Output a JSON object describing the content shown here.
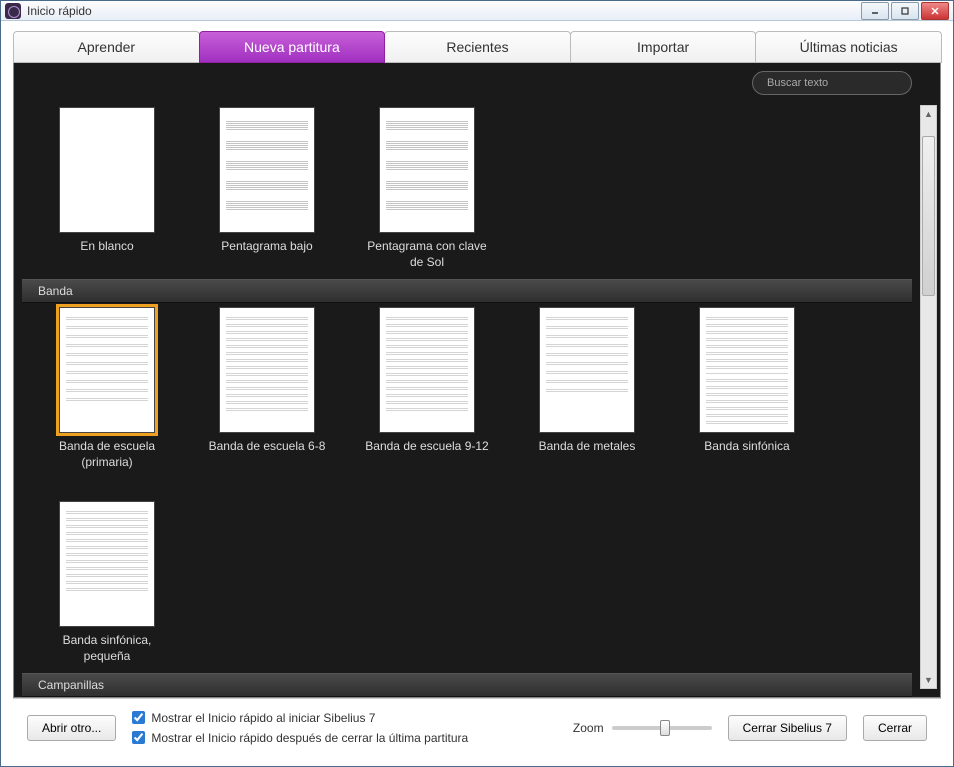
{
  "window_title": "Inicio rápido",
  "tabs": [
    {
      "label": "Aprender"
    },
    {
      "label": "Nueva partitura",
      "active": true
    },
    {
      "label": "Recientes"
    },
    {
      "label": "Importar"
    },
    {
      "label": "Últimas noticias"
    }
  ],
  "search_placeholder": "Buscar texto",
  "top_templates": [
    {
      "label": "En blanco",
      "type": "blank"
    },
    {
      "label": "Pentagrama bajo",
      "type": "staff5"
    },
    {
      "label": "Pentagrama con clave de Sol",
      "type": "staff5"
    }
  ],
  "section_banda": {
    "title": "Banda",
    "templates": [
      {
        "label": "Banda de escuela (primaria)",
        "selected": true
      },
      {
        "label": "Banda de escuela 6-8"
      },
      {
        "label": "Banda de escuela 9-12"
      },
      {
        "label": "Banda de metales"
      },
      {
        "label": "Banda sinfónica"
      },
      {
        "label": "Banda sinfónica, pequeña"
      }
    ]
  },
  "section_campanillas": {
    "title": "Campanillas"
  },
  "footer": {
    "open_other": "Abrir otro...",
    "check1": "Mostrar el Inicio rápido al iniciar Sibelius 7",
    "check2": "Mostrar el Inicio rápido después de cerrar la última partitura",
    "zoom": "Zoom",
    "close_sibelius": "Cerrar Sibelius 7",
    "close": "Cerrar"
  }
}
